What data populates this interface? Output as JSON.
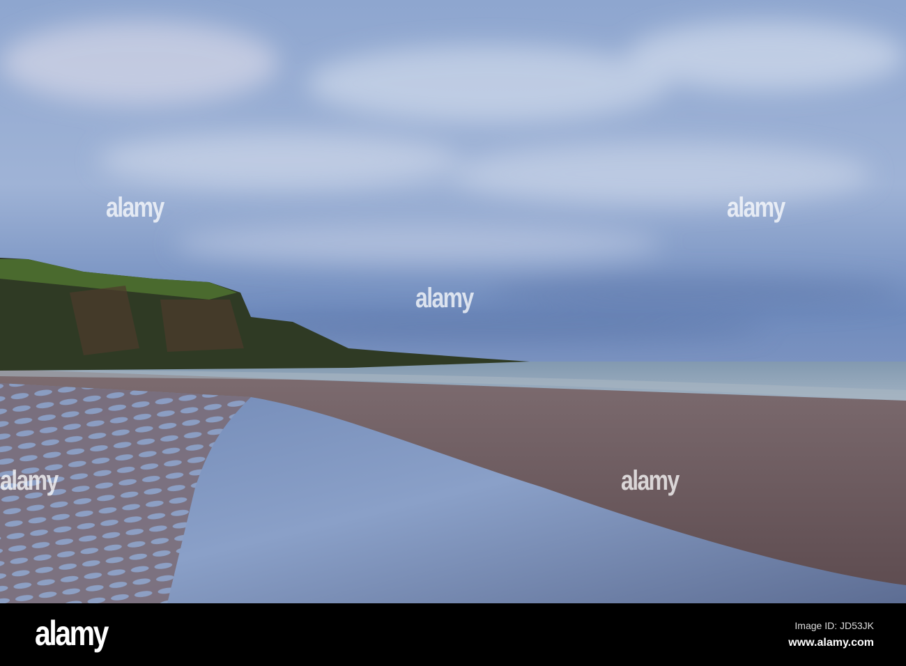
{
  "watermark": {
    "text": "alamy"
  },
  "footer": {
    "logo": "alamy",
    "image_id": "Image ID: JD53JK",
    "url": "www.alamy.com"
  },
  "colors": {
    "sky": "#7f99c4",
    "sea": "#8aa3b8",
    "sand": "#6f5a5c",
    "cliff": "#2d3a22"
  }
}
